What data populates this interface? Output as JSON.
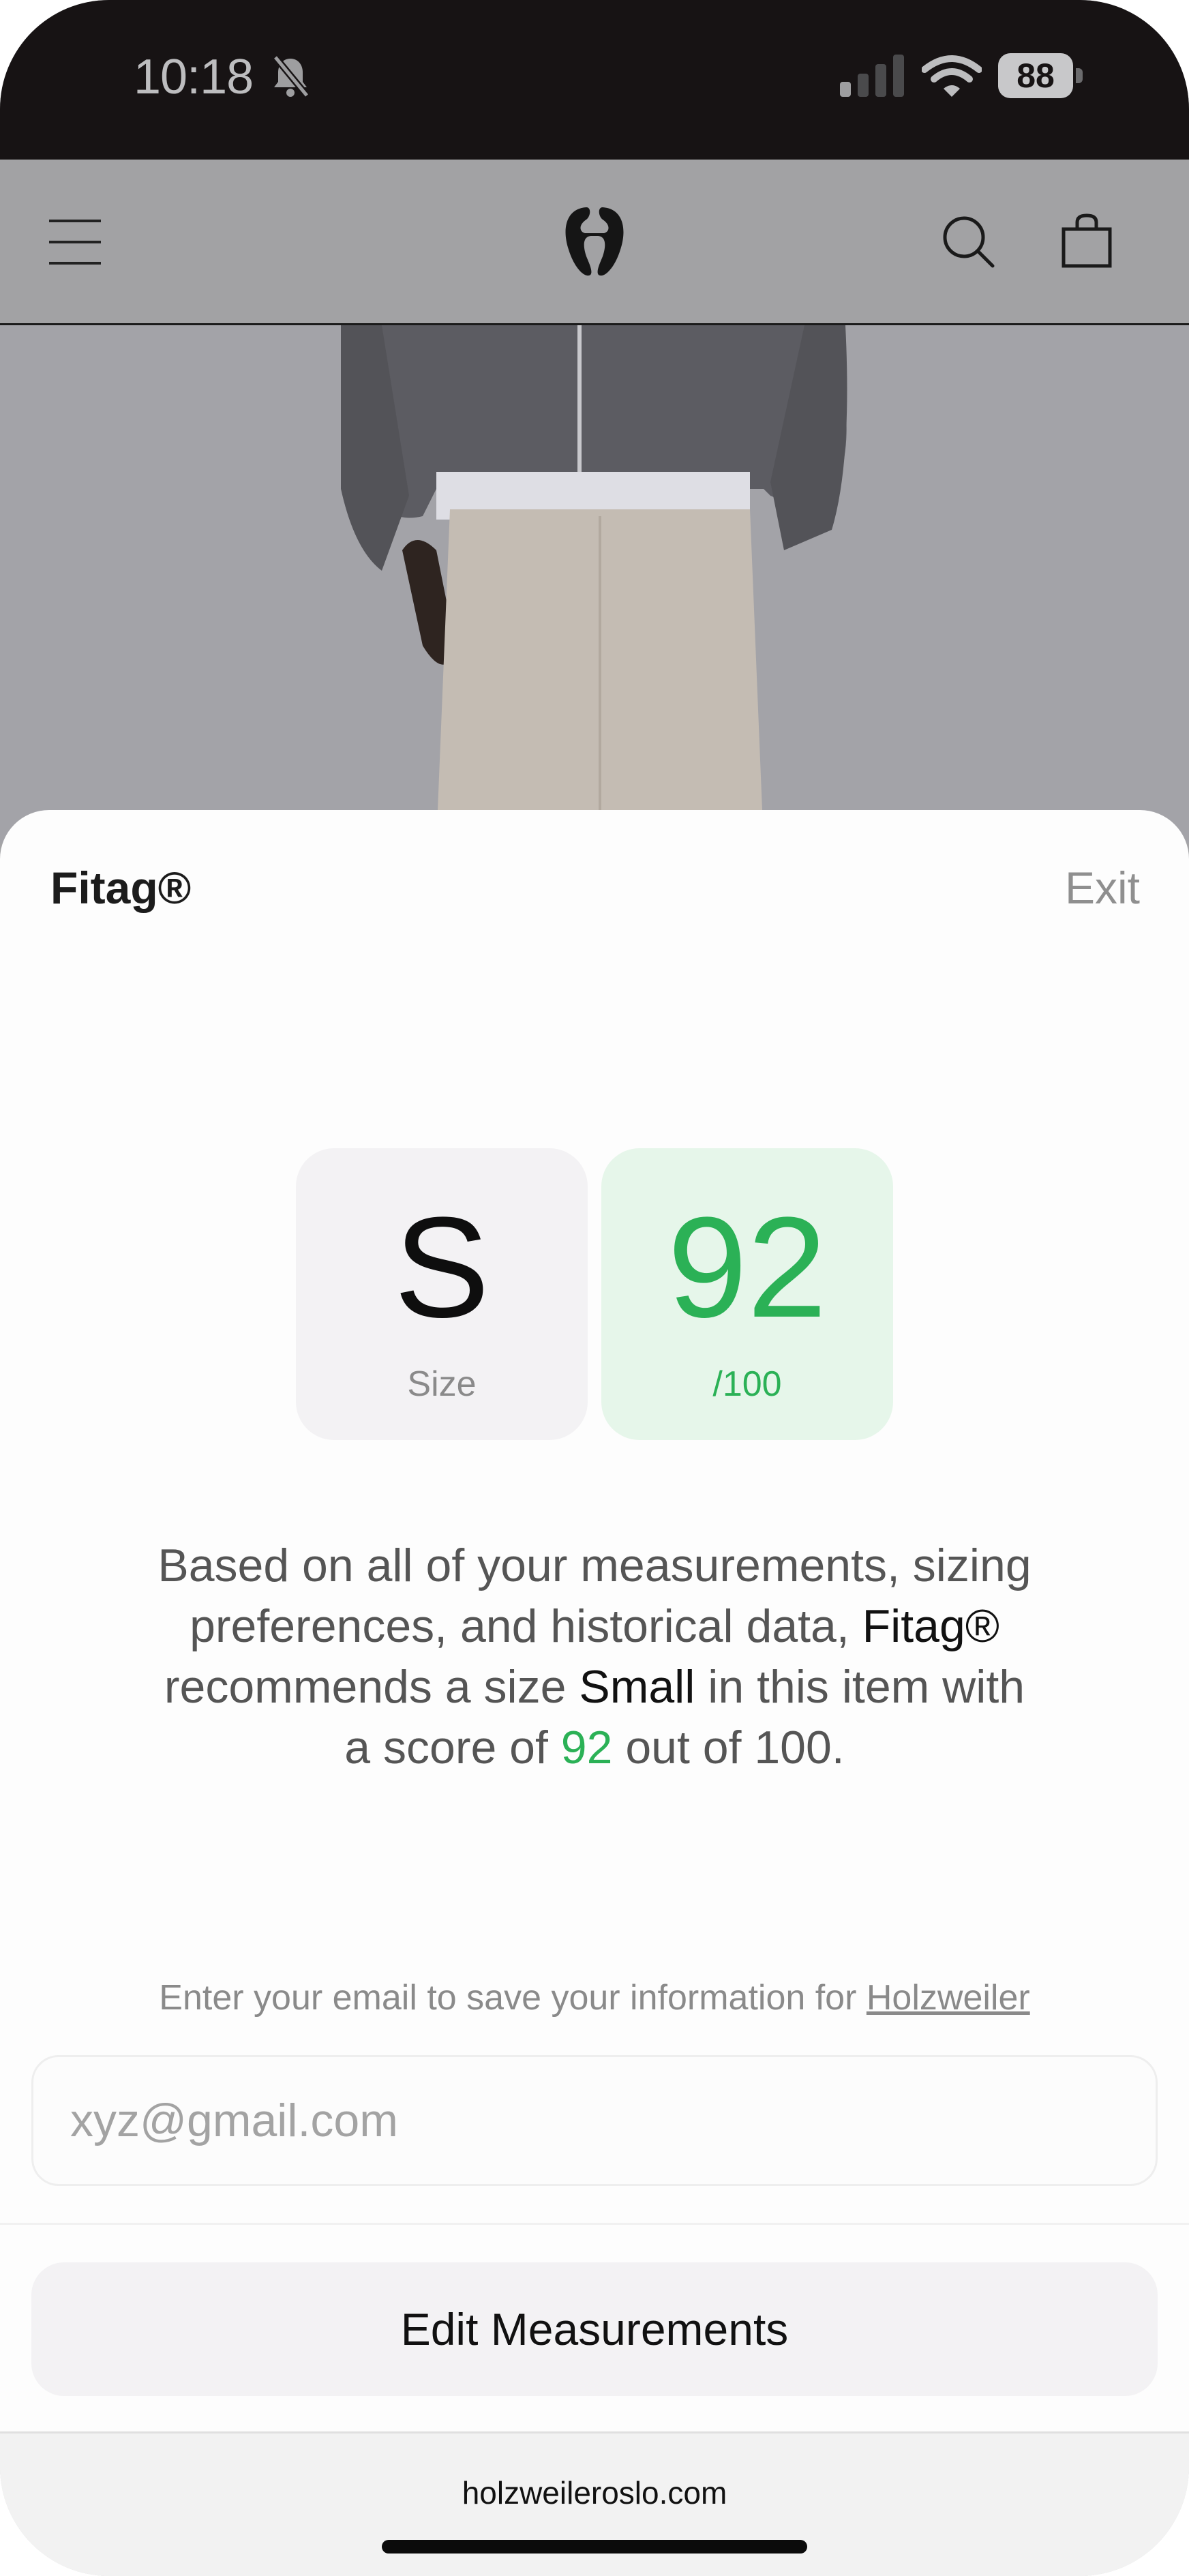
{
  "status_bar": {
    "time": "10:18",
    "battery": "88"
  },
  "icons": [
    "bell-off-icon",
    "signal-icon",
    "wifi-icon",
    "battery-icon",
    "menu-icon",
    "brand-logo",
    "search-icon",
    "bag-icon"
  ],
  "sheet": {
    "title": "Fitag®",
    "exit_label": "Exit",
    "size_value": "S",
    "size_label": "Size",
    "score_value": "92",
    "score_label": "/100",
    "description": {
      "part1": "Based on all of your measurements, sizing preferences, and historical data, ",
      "brand": "Fitag®",
      "part2": " recommends a size ",
      "size_word": "Small",
      "part3": " in this item with a score of ",
      "score": "92",
      "part4": " out of 100."
    },
    "email_prompt": "Enter your email to save your information for ",
    "email_prompt_link": "Holzweiler",
    "email_placeholder": "xyz@gmail.com",
    "edit_button": "Edit Measurements"
  },
  "browser": {
    "url": "holzweileroslo.com"
  },
  "colors": {
    "accent_green": "#2bb156",
    "score_card_bg": "#e6f6ea",
    "size_card_bg": "#f3f2f4"
  }
}
